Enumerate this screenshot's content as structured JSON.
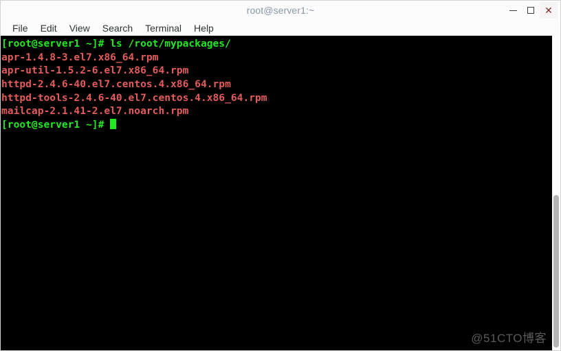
{
  "window": {
    "title": "root@server1:~",
    "controls": {
      "minimize_label": "–",
      "maximize_label": "□",
      "close_label": "✕"
    }
  },
  "menubar": {
    "items": [
      {
        "label": "File"
      },
      {
        "label": "Edit"
      },
      {
        "label": "View"
      },
      {
        "label": "Search"
      },
      {
        "label": "Terminal"
      },
      {
        "label": "Help"
      }
    ]
  },
  "terminal": {
    "background_color": "#000000",
    "prompt_color": "#23e723",
    "output_color": "#e25b5b",
    "prompt": "[root@server1 ~]#",
    "command": " ls /root/mypackages/",
    "lines": [
      {
        "type": "prompt",
        "text": "[root@server1 ~]# ls /root/mypackages/"
      },
      {
        "type": "output",
        "text": "apr-1.4.8-3.el7.x86_64.rpm"
      },
      {
        "type": "output",
        "text": "apr-util-1.5.2-6.el7.x86_64.rpm"
      },
      {
        "type": "output",
        "text": "httpd-2.4.6-40.el7.centos.4.x86_64.rpm"
      },
      {
        "type": "output",
        "text": "httpd-tools-2.4.6-40.el7.centos.4.x86_64.rpm"
      },
      {
        "type": "output",
        "text": "mailcap-2.1.41-2.el7.noarch.rpm"
      },
      {
        "type": "prompt_cursor",
        "text": "[root@server1 ~]# "
      }
    ],
    "watermark": "@51CTO博客"
  }
}
